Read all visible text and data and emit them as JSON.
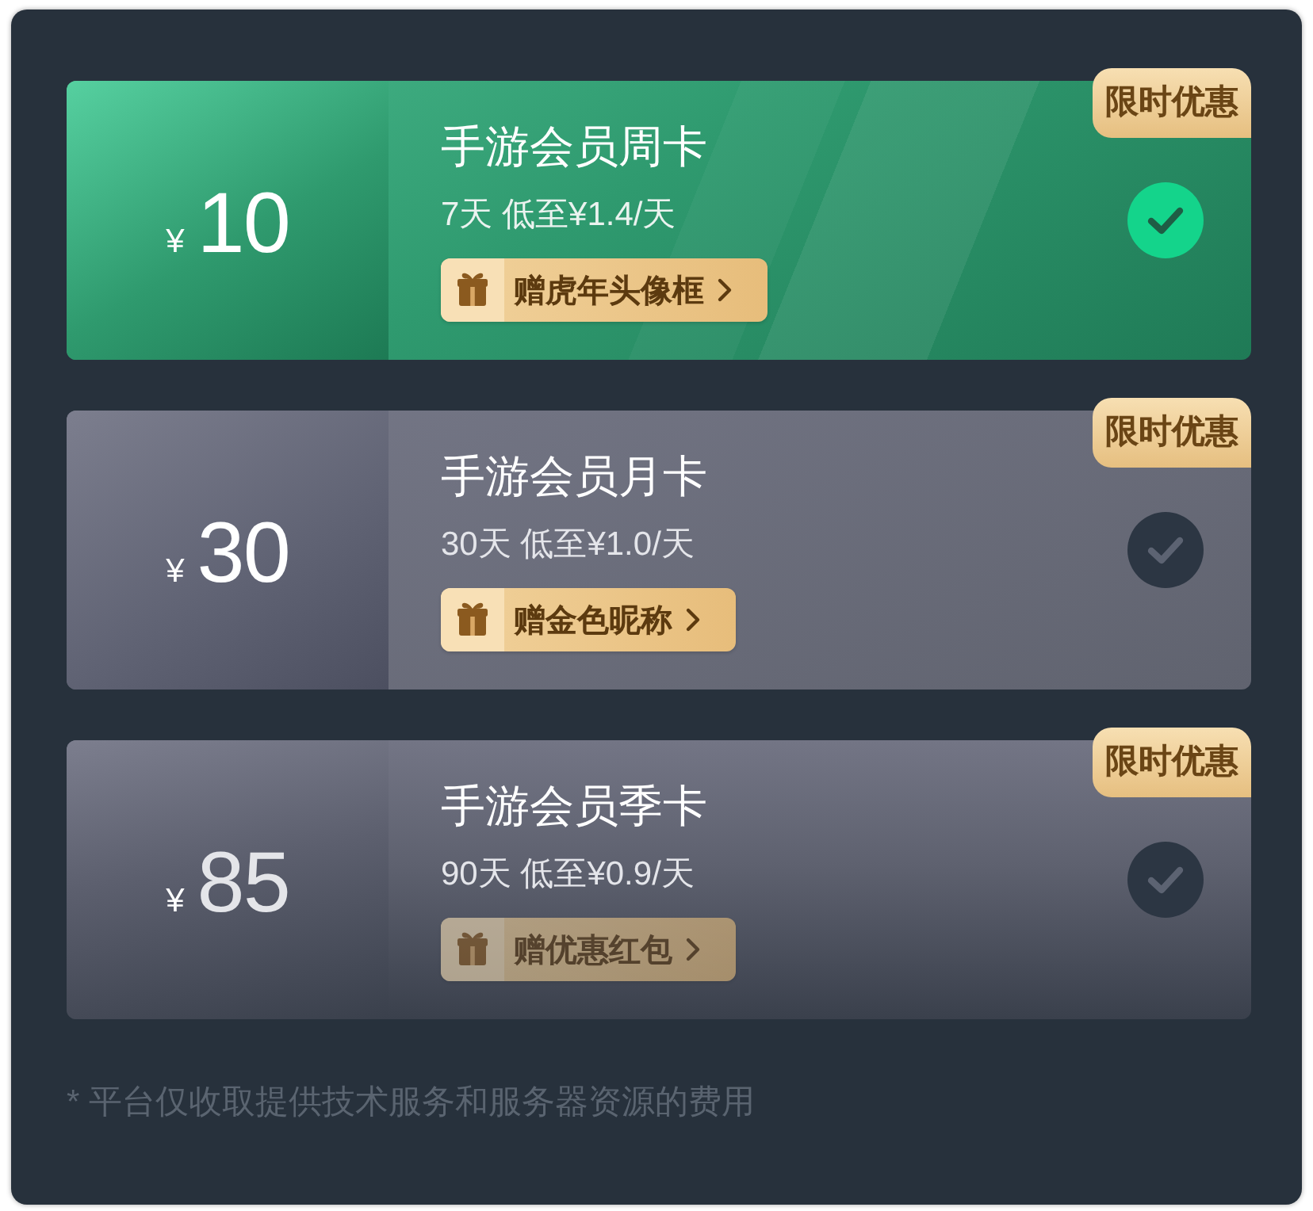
{
  "plans": [
    {
      "currency": "¥",
      "price": "10",
      "title": "手游会员周卡",
      "subtitle": "7天 低至¥1.4/天",
      "gift": "赠虎年头像框",
      "badge": "限时优惠",
      "selected": true
    },
    {
      "currency": "¥",
      "price": "30",
      "title": "手游会员月卡",
      "subtitle": "30天 低至¥1.0/天",
      "gift": "赠金色昵称",
      "badge": "限时优惠",
      "selected": false
    },
    {
      "currency": "¥",
      "price": "85",
      "title": "手游会员季卡",
      "subtitle": "90天 低至¥0.9/天",
      "gift": "赠优惠红包",
      "badge": "限时优惠",
      "selected": false
    }
  ],
  "footnote": "* 平台仅收取提供技术服务和服务器资源的费用"
}
